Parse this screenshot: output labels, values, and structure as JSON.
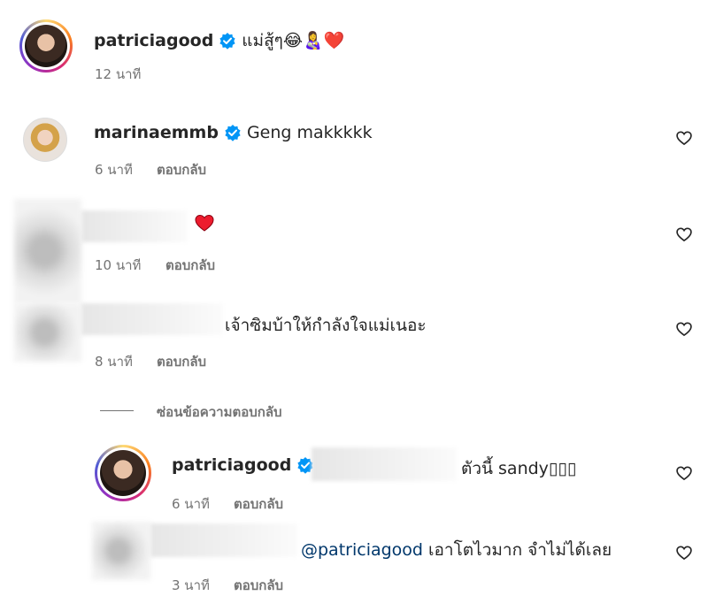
{
  "comments": [
    {
      "username": "patriciagood",
      "text": "แม่สู้ๆ😂👩‍🍼❤️",
      "time": "12 นาที",
      "reply": ""
    },
    {
      "username": "marinaemmb",
      "text": "Geng makkkkk",
      "time": "6 นาที",
      "reply": "ตอบกลับ"
    },
    {
      "username": "",
      "text": "❤️",
      "time": "10 นาที",
      "reply": "ตอบกลับ"
    },
    {
      "username": "",
      "text": "เจ้าซิมบ้าให้กำลังใจแม่เนอะ",
      "time": "8 นาที",
      "reply": "ตอบกลับ"
    }
  ],
  "hide_replies_label": "ซ่อนข้อความตอบกลับ",
  "replies": [
    {
      "username": "patriciagood",
      "text": "ตัวนี้ sandy▯▯▯",
      "time": "6 นาที",
      "reply": "ตอบกลับ"
    },
    {
      "mention": "@patriciagood",
      "text": "เอาโตไวมาก จำไม่ได้เลย",
      "time": "3 นาที",
      "reply": "ตอบกลับ"
    }
  ],
  "icons": {
    "verified": "verified-badge-icon",
    "like": "heart-outline-icon"
  },
  "colors": {
    "verified": "#0095f6",
    "heart": "#ed4956"
  }
}
